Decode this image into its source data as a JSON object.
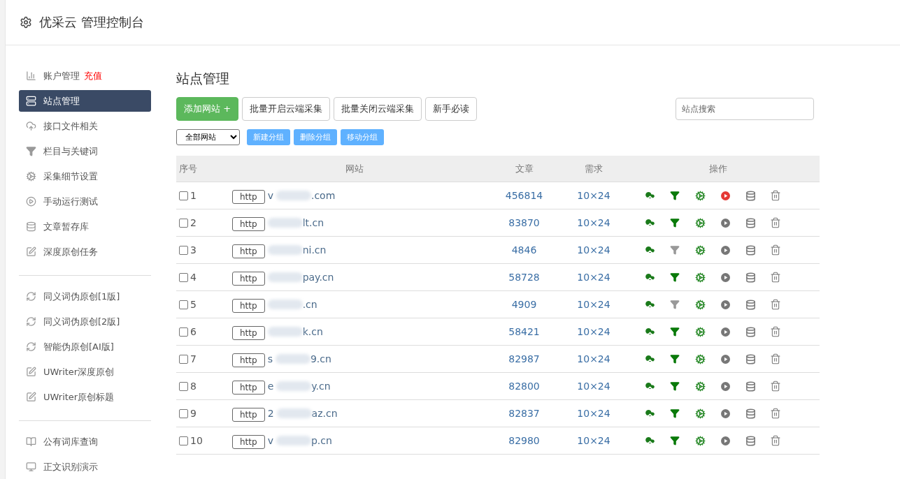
{
  "header": {
    "title": "优采云 管理控制台"
  },
  "sidebar": {
    "groups": [
      [
        {
          "label": "账户管理",
          "badge": "充值",
          "selected": false
        },
        {
          "label": "站点管理",
          "selected": true
        },
        {
          "label": "接口文件相关",
          "selected": false
        },
        {
          "label": "栏目与关键词",
          "selected": false
        },
        {
          "label": "采集细节设置",
          "selected": false
        },
        {
          "label": "手动运行测试",
          "selected": false
        },
        {
          "label": "文章暂存库",
          "selected": false
        },
        {
          "label": "深度原创任务",
          "selected": false
        }
      ],
      [
        {
          "label": "同义词伪原创[1版]",
          "selected": false
        },
        {
          "label": "同义词伪原创[2版]",
          "selected": false
        },
        {
          "label": "智能伪原创[AI版]",
          "selected": false
        },
        {
          "label": "UWriter深度原创",
          "selected": false
        },
        {
          "label": "UWriter原创标题",
          "selected": false
        }
      ],
      [
        {
          "label": "公有词库查询",
          "selected": false
        },
        {
          "label": "正文识别演示",
          "selected": false
        }
      ]
    ]
  },
  "page_title": "站点管理",
  "toolbar": {
    "primary": "添加网站 +",
    "buttons": [
      "批量开启云端采集",
      "批量关闭云端采集",
      "新手必读"
    ],
    "search": {
      "placeholder": "站点搜索"
    }
  },
  "group_bar": {
    "select": "全部网站",
    "buttons": [
      "新建分组",
      "删除分组",
      "移动分组"
    ]
  },
  "table": {
    "columns": [
      "序号",
      "网站",
      "文章",
      "需求",
      "操作"
    ],
    "rows": [
      {
        "no": "1",
        "checked": false,
        "scheme": "http",
        "prefix": "v",
        "suffix": ".com",
        "articles": "456814",
        "demand": "10×24",
        "filter_on": true,
        "running": true
      },
      {
        "no": "2",
        "checked": false,
        "scheme": "http",
        "prefix": "",
        "suffix": "lt.cn",
        "articles": "83870",
        "demand": "10×24",
        "filter_on": true,
        "running": false
      },
      {
        "no": "3",
        "checked": false,
        "scheme": "http",
        "prefix": "",
        "suffix": "ni.cn",
        "articles": "4846",
        "demand": "10×24",
        "filter_on": false,
        "running": false
      },
      {
        "no": "4",
        "checked": false,
        "scheme": "http",
        "prefix": "",
        "suffix": "pay.cn",
        "articles": "58728",
        "demand": "10×24",
        "filter_on": true,
        "running": false
      },
      {
        "no": "5",
        "checked": false,
        "scheme": "http",
        "prefix": "",
        "suffix": ".cn",
        "articles": "4909",
        "demand": "10×24",
        "filter_on": false,
        "running": false
      },
      {
        "no": "6",
        "checked": false,
        "scheme": "http",
        "prefix": "",
        "suffix": "k.cn",
        "articles": "58421",
        "demand": "10×24",
        "filter_on": true,
        "running": false
      },
      {
        "no": "7",
        "checked": false,
        "scheme": "http",
        "prefix": "s",
        "suffix": "9.cn",
        "articles": "82987",
        "demand": "10×24",
        "filter_on": true,
        "running": false
      },
      {
        "no": "8",
        "checked": false,
        "scheme": "http",
        "prefix": "e",
        "suffix": "y.cn",
        "articles": "82800",
        "demand": "10×24",
        "filter_on": true,
        "running": false
      },
      {
        "no": "9",
        "checked": false,
        "scheme": "http",
        "prefix": "2",
        "suffix": "az.cn",
        "articles": "82837",
        "demand": "10×24",
        "filter_on": true,
        "running": false
      },
      {
        "no": "10",
        "checked": false,
        "scheme": "http",
        "prefix": "v",
        "suffix": "p.cn",
        "articles": "82980",
        "demand": "10×24",
        "filter_on": true,
        "running": false
      }
    ]
  }
}
